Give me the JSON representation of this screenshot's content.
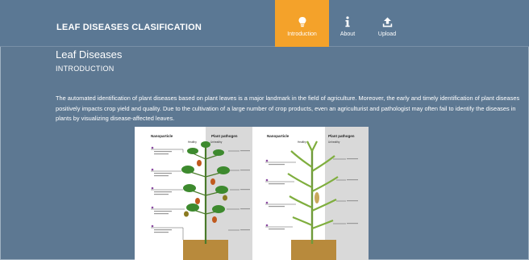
{
  "navbar": {
    "brand": "LEAF DISEASES CLASIFICATION",
    "items": [
      {
        "label": "Introduction",
        "icon": "lightbulb-icon",
        "active": true
      },
      {
        "label": "About",
        "icon": "info-icon",
        "active": false
      },
      {
        "label": "Upload",
        "icon": "upload-icon",
        "active": false
      }
    ]
  },
  "page": {
    "title": "Leaf Diseases",
    "subtitle": "INTRODUCTION",
    "paragraph": "The automated identification of plant diseases based on plant leaves is a major landmark in the field of agriculture. Moreover, the early and timely identification of plant diseases positively impacts crop yield and quality. Due to the cultivation of a large number of crop products, even an agriculturist and pathologist may often fail to identify the diseases in plants by visualizing disease-affected leaves."
  },
  "figure": {
    "left": {
      "col1": "Nanoparticle",
      "col2": "Plant pathogen",
      "sub1": "Healthy",
      "sub2": "Unhealthy"
    },
    "right": {
      "col1": "Nanoparticle",
      "col2": "Plant pathogen",
      "sub1": "Healthy",
      "sub2": "Unhealthy"
    }
  },
  "colors": {
    "background": "#5d7892",
    "navbar": "#5b7894",
    "accent": "#f4a22a"
  }
}
